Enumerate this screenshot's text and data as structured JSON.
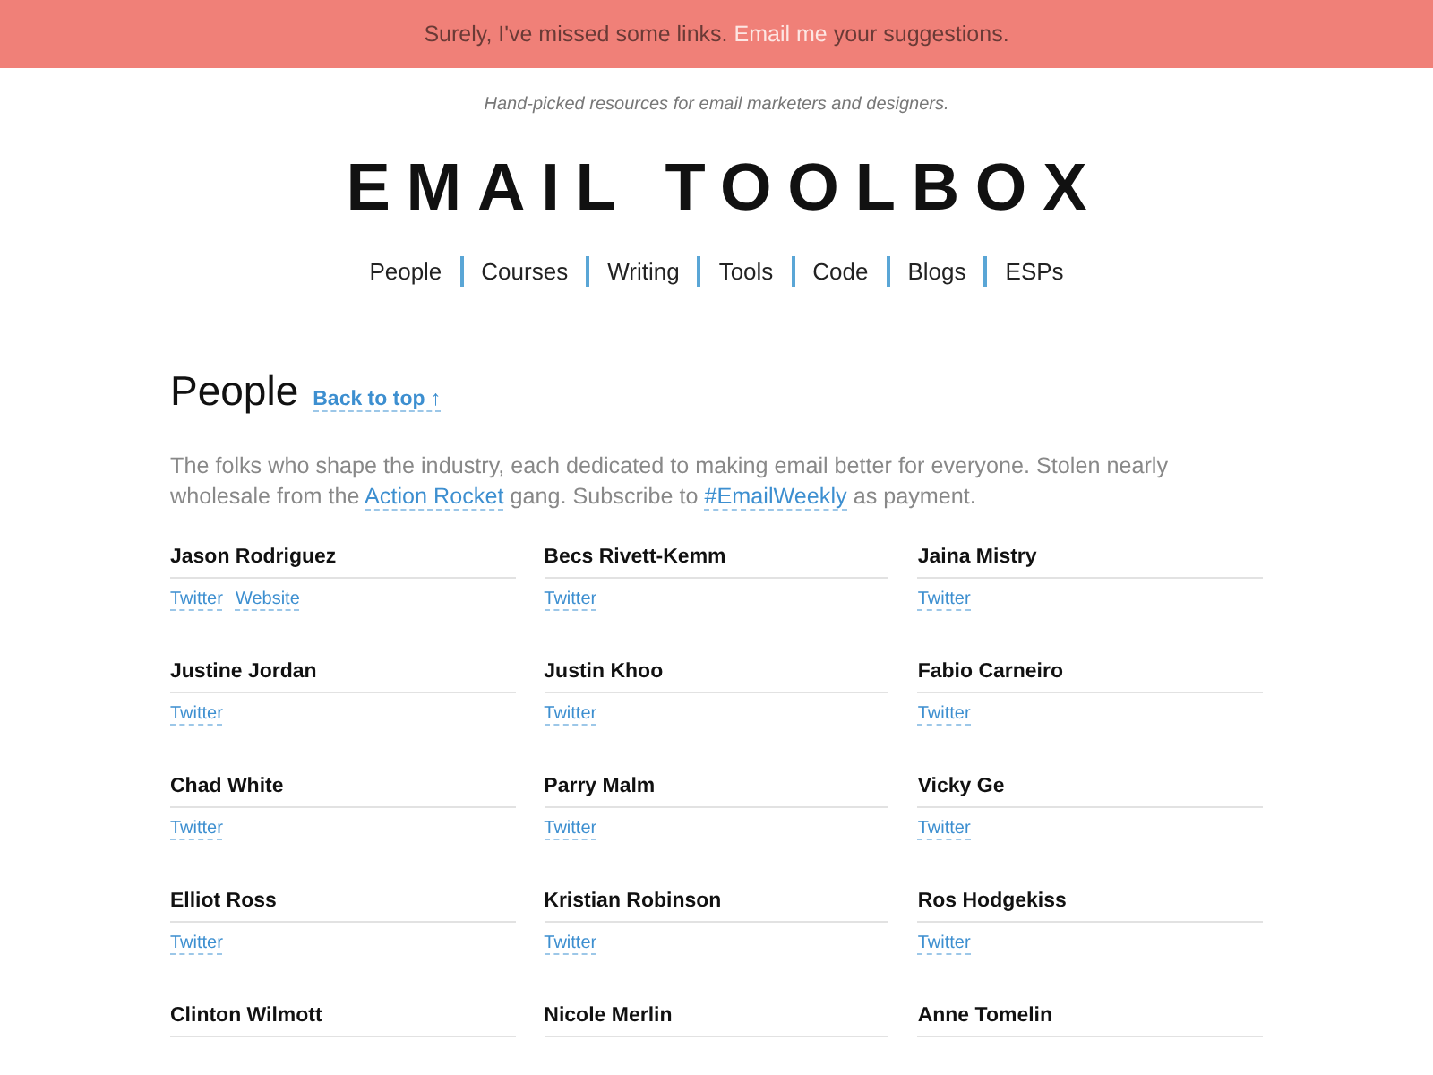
{
  "banner": {
    "before": "Surely, I've missed some links.",
    "link": "Email me",
    "after": "your suggestions."
  },
  "tagline": "Hand-picked resources for email marketers and designers.",
  "title": "EMAIL TOOLBOX",
  "nav": [
    "People",
    "Courses",
    "Writing",
    "Tools",
    "Code",
    "Blogs",
    "ESPs"
  ],
  "section": {
    "heading": "People",
    "back_link": "Back to top ↑",
    "intro": [
      {
        "kind": "text",
        "text": "The folks who shape the industry, each dedicated to making email better for everyone. Stolen nearly wholesale from the"
      },
      {
        "kind": "link",
        "text": "Action Rocket"
      },
      {
        "kind": "text",
        "text": "gang. Subscribe to"
      },
      {
        "kind": "link",
        "text": "#EmailWeekly"
      },
      {
        "kind": "text",
        "text": "as payment."
      }
    ],
    "people": [
      {
        "name": "Jason Rodriguez",
        "links": [
          "Twitter",
          "Website"
        ]
      },
      {
        "name": "Becs Rivett-Kemm",
        "links": [
          "Twitter"
        ]
      },
      {
        "name": "Jaina Mistry",
        "links": [
          "Twitter"
        ]
      },
      {
        "name": "Justine Jordan",
        "links": [
          "Twitter"
        ]
      },
      {
        "name": "Justin Khoo",
        "links": [
          "Twitter"
        ]
      },
      {
        "name": "Fabio Carneiro",
        "links": [
          "Twitter"
        ]
      },
      {
        "name": "Chad White",
        "links": [
          "Twitter"
        ]
      },
      {
        "name": "Parry Malm",
        "links": [
          "Twitter"
        ]
      },
      {
        "name": "Vicky Ge",
        "links": [
          "Twitter"
        ]
      },
      {
        "name": "Elliot Ross",
        "links": [
          "Twitter"
        ]
      },
      {
        "name": "Kristian Robinson",
        "links": [
          "Twitter"
        ]
      },
      {
        "name": "Ros Hodgekiss",
        "links": [
          "Twitter"
        ]
      },
      {
        "name": "Clinton Wilmott"
      },
      {
        "name": "Nicole Merlin"
      },
      {
        "name": "Anne Tomelin"
      }
    ]
  }
}
